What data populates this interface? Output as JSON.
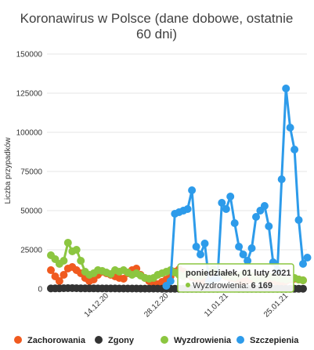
{
  "chart_data": {
    "type": "line",
    "title_line1": "Koronawirus w Polsce (dane dobowe, ostatnie",
    "title_line2": "60 dni)",
    "xlabel": "",
    "ylabel": "Liczba przypadków",
    "ylim": [
      0,
      150000
    ],
    "yticks": [
      0,
      25000,
      50000,
      75000,
      100000,
      125000,
      150000
    ],
    "ytick_labels": [
      "0",
      "25000",
      "50000",
      "75000",
      "100000",
      "125000",
      "150000"
    ],
    "xtick_labels": [
      "14.12.20",
      "28.12.20",
      "11.01.21",
      "25.01.21"
    ],
    "xtick_days": [
      13,
      27,
      41,
      55
    ],
    "day_count": 60,
    "grid": true,
    "legend_position": "bottom",
    "series": [
      {
        "name": "Zachorowania",
        "color": "#f05a1f",
        "values": [
          12000,
          8000,
          5000,
          9000,
          13000,
          14000,
          12000,
          10000,
          7000,
          5000,
          6000,
          9000,
          11000,
          10000,
          9000,
          8000,
          7000,
          6500,
          10000,
          12000,
          13000,
          9000,
          7000,
          5000,
          4000,
          3000,
          4500,
          6000,
          8000,
          11000,
          12500,
          11000,
          9000,
          7500,
          6500,
          5500,
          5000,
          6000,
          7000,
          8500,
          9000,
          8000,
          7000,
          6500,
          5000,
          4500,
          5500,
          6500,
          7000,
          7000,
          6500,
          6000,
          5500,
          4000,
          3500,
          5000,
          6000,
          6500,
          6000,
          5500
        ]
      },
      {
        "name": "Zgony",
        "color": "#333333",
        "values": [
          300,
          350,
          400,
          450,
          500,
          480,
          450,
          420,
          380,
          350,
          330,
          320,
          310,
          300,
          290,
          280,
          270,
          260,
          250,
          240,
          230,
          220,
          210,
          200,
          190,
          180,
          170,
          160,
          150,
          140,
          130,
          120,
          110,
          100,
          90,
          80,
          100,
          120,
          140,
          160,
          180,
          200,
          190,
          180,
          170,
          160,
          150,
          140,
          130,
          120,
          110,
          100,
          90,
          80,
          70,
          60,
          80,
          100,
          120,
          140
        ]
      },
      {
        "name": "Wyzdrowienia",
        "color": "#8cc640",
        "values": [
          21500,
          19000,
          16000,
          18000,
          29500,
          24000,
          25000,
          18000,
          11000,
          9000,
          10000,
          12000,
          11500,
          10500,
          9500,
          12000,
          11000,
          12000,
          10500,
          9000,
          10000,
          8500,
          7000,
          6500,
          7000,
          9000,
          10000,
          11000,
          12000,
          10500,
          9000,
          8000,
          9500,
          9000,
          8000,
          8000,
          9000,
          11000,
          12500,
          10000,
          9000,
          8500,
          8000,
          7500,
          8500,
          9500,
          10000,
          8000,
          6169,
          6500,
          7000,
          8000,
          7500,
          7000,
          6500,
          6000,
          6500,
          7000,
          6000,
          5500
        ]
      },
      {
        "name": "Szczepienia",
        "color": "#2d9bea",
        "values": [
          null,
          null,
          null,
          null,
          null,
          null,
          null,
          null,
          null,
          null,
          null,
          null,
          null,
          null,
          null,
          null,
          null,
          null,
          null,
          null,
          null,
          null,
          null,
          null,
          null,
          null,
          null,
          2000,
          5000,
          48000,
          49000,
          50000,
          51000,
          63000,
          27000,
          22000,
          29000,
          5000,
          6000,
          7000,
          55000,
          51000,
          59000,
          42000,
          27000,
          22000,
          18000,
          26000,
          46000,
          50000,
          53000,
          40000,
          17000,
          12000,
          70000,
          128000,
          103000,
          89000,
          44000,
          16000,
          20000
        ]
      }
    ]
  },
  "tooltip": {
    "date": "poniedziałek, 01 luty 2021",
    "series_label": "Wyzdrowienia",
    "value": "6 169",
    "border_color": "#8cc640"
  }
}
